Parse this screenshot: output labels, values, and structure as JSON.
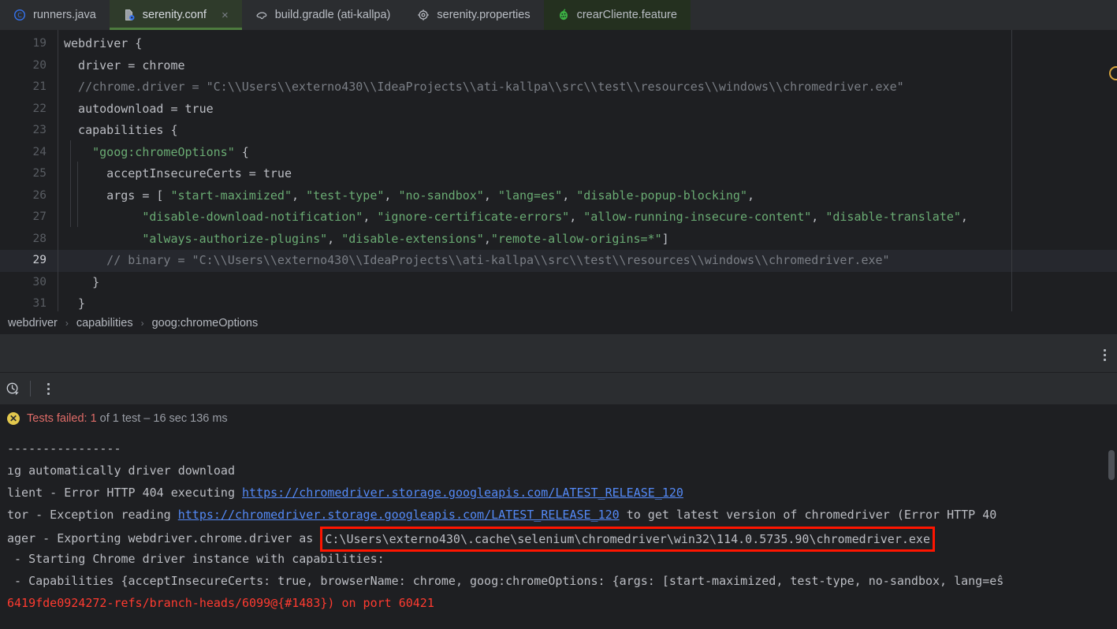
{
  "tabs": [
    {
      "label": "runners.java",
      "icon": "java-class-icon",
      "state": "inactive",
      "closable": false
    },
    {
      "label": "serenity.conf",
      "icon": "conf-file-icon",
      "state": "active",
      "closable": true,
      "close_label": "×"
    },
    {
      "label": "build.gradle (ati-kallpa)",
      "icon": "gradle-elephant-icon",
      "state": "inactive",
      "closable": false
    },
    {
      "label": "serenity.properties",
      "icon": "properties-gear-icon",
      "state": "inactive",
      "closable": false
    },
    {
      "label": "crearCliente.feature",
      "icon": "cucumber-icon",
      "state": "inactive",
      "closable": false
    }
  ],
  "editor": {
    "current_line": 29,
    "lines": [
      {
        "num": "19",
        "tokens": [
          {
            "t": "webdriver {",
            "k": "p"
          }
        ]
      },
      {
        "num": "20",
        "tokens": [
          {
            "t": "  driver = chrome",
            "k": "p"
          }
        ]
      },
      {
        "num": "21",
        "tokens": [
          {
            "t": "  //chrome.driver = \"C:\\\\Users\\\\externo430\\\\IdeaProjects\\\\ati-kallpa\\\\src\\\\test\\\\resources\\\\windows\\\\chromedriver.exe\"",
            "k": "c"
          }
        ]
      },
      {
        "num": "22",
        "tokens": [
          {
            "t": "  autodownload = true",
            "k": "p"
          }
        ]
      },
      {
        "num": "23",
        "tokens": [
          {
            "t": "  capabilities {",
            "k": "p"
          }
        ]
      },
      {
        "num": "24",
        "tokens": [
          {
            "t": "    ",
            "k": "p"
          },
          {
            "t": "\"goog:chromeOptions\"",
            "k": "s"
          },
          {
            "t": " {",
            "k": "p"
          }
        ]
      },
      {
        "num": "25",
        "tokens": [
          {
            "t": "      acceptInsecureCerts = true",
            "k": "p"
          }
        ]
      },
      {
        "num": "26",
        "tokens": [
          {
            "t": "      args = [ ",
            "k": "p"
          },
          {
            "t": "\"start-maximized\"",
            "k": "s"
          },
          {
            "t": ", ",
            "k": "p"
          },
          {
            "t": "\"test-type\"",
            "k": "s"
          },
          {
            "t": ", ",
            "k": "p"
          },
          {
            "t": "\"no-sandbox\"",
            "k": "s"
          },
          {
            "t": ", ",
            "k": "p"
          },
          {
            "t": "\"lang=es\"",
            "k": "s"
          },
          {
            "t": ", ",
            "k": "p"
          },
          {
            "t": "\"disable-popup-blocking\"",
            "k": "s"
          },
          {
            "t": ",",
            "k": "p"
          }
        ]
      },
      {
        "num": "27",
        "tokens": [
          {
            "t": "           ",
            "k": "p"
          },
          {
            "t": "\"disable-download-notification\"",
            "k": "s"
          },
          {
            "t": ", ",
            "k": "p"
          },
          {
            "t": "\"ignore-certificate-errors\"",
            "k": "s"
          },
          {
            "t": ", ",
            "k": "p"
          },
          {
            "t": "\"allow-running-insecure-content\"",
            "k": "s"
          },
          {
            "t": ", ",
            "k": "p"
          },
          {
            "t": "\"disable-translate\"",
            "k": "s"
          },
          {
            "t": ",",
            "k": "p"
          }
        ]
      },
      {
        "num": "28",
        "tokens": [
          {
            "t": "           ",
            "k": "p"
          },
          {
            "t": "\"always-authorize-plugins\"",
            "k": "s"
          },
          {
            "t": ", ",
            "k": "p"
          },
          {
            "t": "\"disable-extensions\"",
            "k": "s"
          },
          {
            "t": ",",
            "k": "p"
          },
          {
            "t": "\"remote-allow-origins=*\"",
            "k": "s"
          },
          {
            "t": "]",
            "k": "p"
          }
        ]
      },
      {
        "num": "29",
        "tokens": [
          {
            "t": "      // binary = \"C:\\\\Users\\\\externo430\\\\IdeaProjects\\\\ati-kallpa\\\\src\\\\test\\\\resources\\\\windows\\\\chromedriver.exe\"",
            "k": "c"
          }
        ]
      },
      {
        "num": "30",
        "tokens": [
          {
            "t": "    }",
            "k": "p"
          }
        ]
      },
      {
        "num": "31",
        "tokens": [
          {
            "t": "  }",
            "k": "p"
          }
        ]
      }
    ]
  },
  "breadcrumb": {
    "separator": "›",
    "items": [
      "webdriver",
      "capabilities",
      "goog:chromeOptions"
    ]
  },
  "run_toolbar": {
    "history_icon": "history-clock-icon",
    "more_icon": "more-vertical-icon",
    "top_more_icon": "more-vertical-icon"
  },
  "status": {
    "badge_icon": "test-failed-icon",
    "badge_glyph": "✕",
    "failed_text": "Tests failed: 1",
    "rest_text": " of 1 test – 16 sec 136 ms"
  },
  "console": {
    "lines": [
      {
        "id": "sep",
        "segments": [
          {
            "t": "----------------",
            "k": "plain"
          }
        ]
      },
      {
        "id": "autodl",
        "segments": [
          {
            "t": "ıg automatically driver download",
            "k": "plain"
          }
        ]
      },
      {
        "id": "http404",
        "segments": [
          {
            "t": "lient - Error HTTP 404 executing ",
            "k": "plain"
          },
          {
            "t": "https://chromedriver.storage.googleapis.com/LATEST_RELEASE_120",
            "k": "link"
          }
        ]
      },
      {
        "id": "exception",
        "segments": [
          {
            "t": "tor - Exception reading ",
            "k": "plain"
          },
          {
            "t": "https://chromedriver.storage.googleapis.com/LATEST_RELEASE_120",
            "k": "link"
          },
          {
            "t": " to get latest version of chromedriver (Error HTTP 40",
            "k": "plain"
          }
        ]
      },
      {
        "id": "export",
        "segments": [
          {
            "t": "ager - Exporting webdriver.chrome.driver as ",
            "k": "plain"
          },
          {
            "t": "C:\\Users\\externo430\\.cache\\selenium\\chromedriver\\win32\\114.0.5735.90\\chromedriver.exe",
            "k": "boxed"
          }
        ]
      },
      {
        "id": "starting",
        "segments": [
          {
            "t": " - Starting Chrome driver instance with capabilities:",
            "k": "plain"
          }
        ]
      },
      {
        "id": "caps",
        "segments": [
          {
            "t": " - Capabilities {acceptInsecureCerts: true, browserName: chrome, goog:chromeOptions: {args: [start-maximized, test-type, no-sandbox, lang=eŝ",
            "k": "plain"
          }
        ]
      },
      {
        "id": "port",
        "segments": [
          {
            "t": "6419fde0924272-refs/branch-heads/6099@{#1483}) on port 60421",
            "k": "red"
          }
        ]
      }
    ],
    "scrollbar": "vertical-scrollbar"
  },
  "colors": {
    "accent_green": "#4d7b3e",
    "string_green": "#6aab73",
    "link_blue": "#548af7",
    "error_red": "#ff1500",
    "fail_badge": "#e3c84d"
  }
}
